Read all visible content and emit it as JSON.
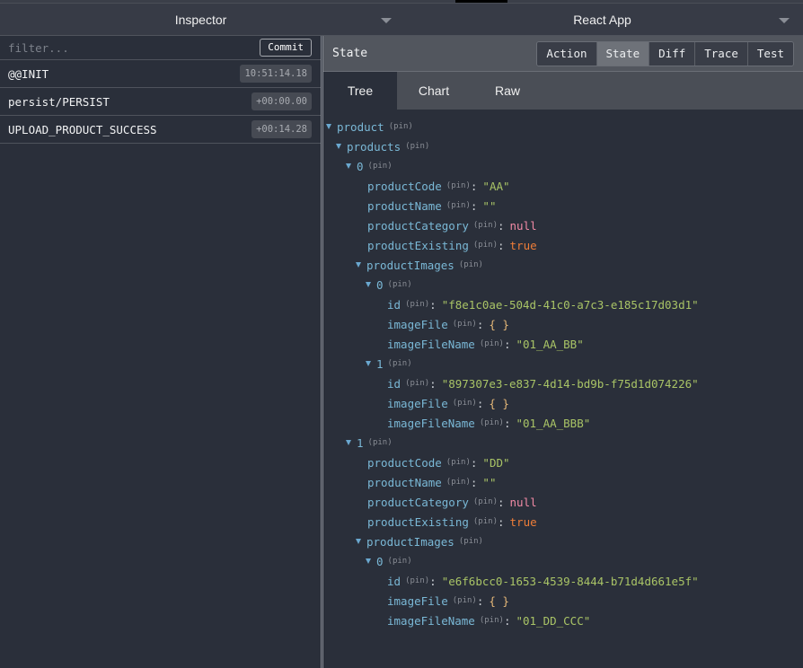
{
  "window": {
    "left_title": "Inspector",
    "right_title": "React App"
  },
  "left_panel": {
    "filter": {
      "value": "",
      "placeholder": "filter..."
    },
    "commit_label": "Commit",
    "actions": [
      {
        "name": "@@INIT",
        "time": "10:51:14.18"
      },
      {
        "name": "persist/PERSIST",
        "time": "+00:00.00"
      },
      {
        "name": "UPLOAD_PRODUCT_SUCCESS",
        "time": "+00:14.28"
      }
    ]
  },
  "right_panel": {
    "title": "State",
    "monitor_buttons": [
      {
        "label": "Action",
        "active": false
      },
      {
        "label": "State",
        "active": true
      },
      {
        "label": "Diff",
        "active": false
      },
      {
        "label": "Trace",
        "active": false
      },
      {
        "label": "Test",
        "active": false
      }
    ],
    "tabs": [
      {
        "label": "Tree",
        "active": true
      },
      {
        "label": "Chart",
        "active": false
      },
      {
        "label": "Raw",
        "active": false
      }
    ],
    "pin_label": "(pin)",
    "tree": [
      {
        "depth": 0,
        "key": "product",
        "expanded": true
      },
      {
        "depth": 1,
        "key": "products",
        "expanded": true
      },
      {
        "depth": 2,
        "key": "0",
        "expanded": true
      },
      {
        "depth": 3,
        "key": "productCode",
        "value": "\"AA\"",
        "type": "string"
      },
      {
        "depth": 3,
        "key": "productName",
        "value": "\"\"",
        "type": "string"
      },
      {
        "depth": 3,
        "key": "productCategory",
        "value": "null",
        "type": "null"
      },
      {
        "depth": 3,
        "key": "productExisting",
        "value": "true",
        "type": "bool"
      },
      {
        "depth": 3,
        "key": "productImages",
        "expanded": true
      },
      {
        "depth": 4,
        "key": "0",
        "expanded": true
      },
      {
        "depth": 5,
        "key": "id",
        "value": "\"f8e1c0ae-504d-41c0-a7c3-e185c17d03d1\"",
        "type": "string"
      },
      {
        "depth": 5,
        "key": "imageFile",
        "value": "{ }",
        "type": "object"
      },
      {
        "depth": 5,
        "key": "imageFileName",
        "value": "\"01_AA_BB\"",
        "type": "string"
      },
      {
        "depth": 4,
        "key": "1",
        "expanded": true
      },
      {
        "depth": 5,
        "key": "id",
        "value": "\"897307e3-e837-4d14-bd9b-f75d1d074226\"",
        "type": "string"
      },
      {
        "depth": 5,
        "key": "imageFile",
        "value": "{ }",
        "type": "object"
      },
      {
        "depth": 5,
        "key": "imageFileName",
        "value": "\"01_AA_BBB\"",
        "type": "string"
      },
      {
        "depth": 2,
        "key": "1",
        "expanded": true
      },
      {
        "depth": 3,
        "key": "productCode",
        "value": "\"DD\"",
        "type": "string"
      },
      {
        "depth": 3,
        "key": "productName",
        "value": "\"\"",
        "type": "string"
      },
      {
        "depth": 3,
        "key": "productCategory",
        "value": "null",
        "type": "null"
      },
      {
        "depth": 3,
        "key": "productExisting",
        "value": "true",
        "type": "bool"
      },
      {
        "depth": 3,
        "key": "productImages",
        "expanded": true
      },
      {
        "depth": 4,
        "key": "0",
        "expanded": true
      },
      {
        "depth": 5,
        "key": "id",
        "value": "\"e6f6bcc0-1653-4539-8444-b71d4d661e5f\"",
        "type": "string"
      },
      {
        "depth": 5,
        "key": "imageFile",
        "value": "{ }",
        "type": "object"
      },
      {
        "depth": 5,
        "key": "imageFileName",
        "value": "\"01_DD_CCC\"",
        "type": "string"
      }
    ]
  }
}
